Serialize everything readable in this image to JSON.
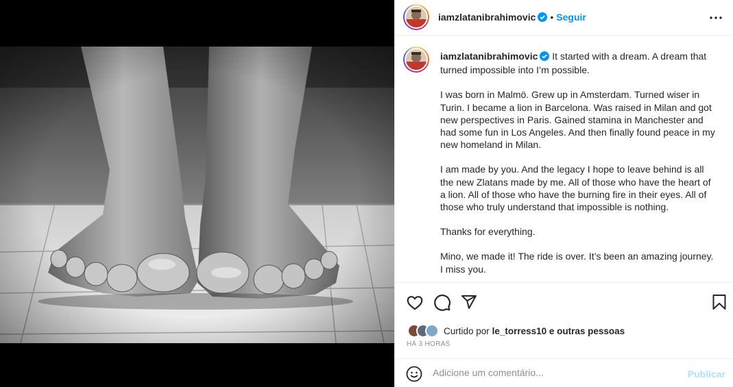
{
  "post": {
    "username": "iamzlatanibrahimovic",
    "verified": true,
    "follow_label": "Seguir",
    "separator": "•",
    "more_icon": "more-horizontal-icon"
  },
  "caption": {
    "username": "iamzlatanibrahimovic",
    "first_line": "It started with a dream. A dream that turned impossible into I’m possible.",
    "paragraphs": [
      "I was born in Malmö. Grew up in Amsterdam. Turned wiser in Turin. I became a lion in Barcelona. Was raised in Milan and got new perspectives in Paris. Gained stamina in Manchester and had some fun in Los Angeles. And then finally found peace in my new homeland in Milan.",
      "I am made by you. And the legacy I hope to leave behind is all the new Zlatans made by me. All of those who have the heart of a lion. All of those who have the burning fire in their eyes. All of those who truly understand that impossible is nothing.",
      "Thanks for everything.",
      "Mino, we made it! The ride is over. It’s been an amazing journey. I miss you."
    ]
  },
  "actions": {
    "icons": [
      "heart-icon",
      "comment-icon",
      "share-icon",
      "bookmark-icon"
    ]
  },
  "likes": {
    "prefix": "Curtido por",
    "user": "le_torress10",
    "suffix": "e outras pessoas"
  },
  "timestamp": "HÁ 3 HORAS",
  "comment": {
    "placeholder": "Adicione um comentário...",
    "publish_label": "Publicar",
    "emoji_icon": "emoji-icon"
  },
  "colors": {
    "link_blue": "#0095f6",
    "publish_disabled": "#b2dffc",
    "verified_blue": "#0095f6",
    "muted": "#8e8e8e"
  }
}
